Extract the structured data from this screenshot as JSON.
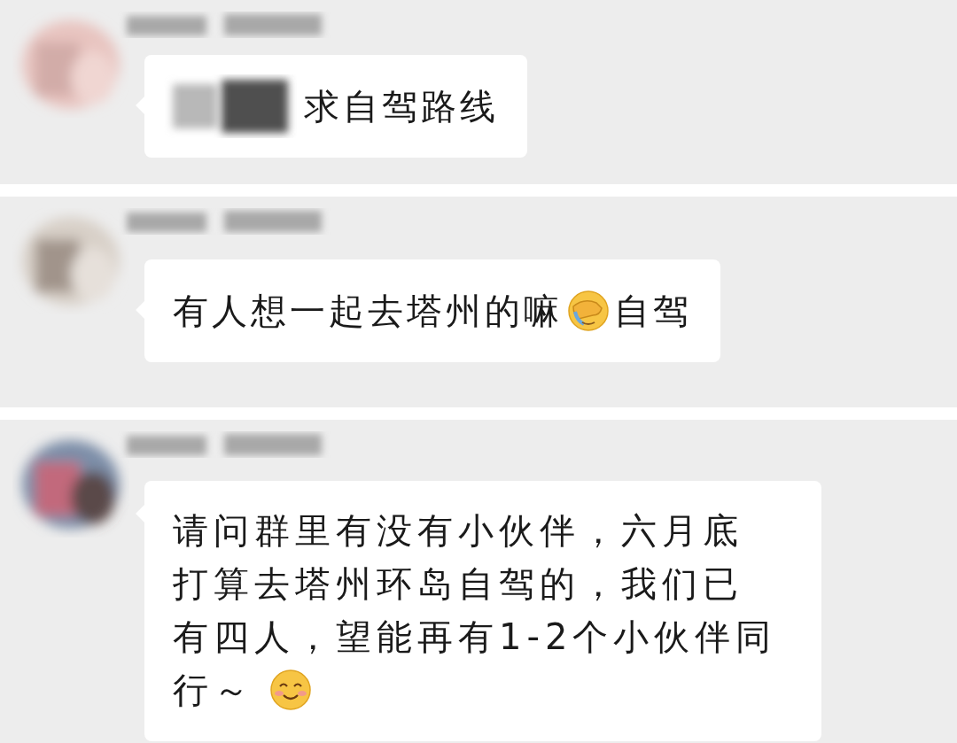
{
  "messages": [
    {
      "segments": [
        {
          "kind": "blurred"
        },
        {
          "kind": "text",
          "text": "求自驾路线"
        }
      ]
    },
    {
      "segments": [
        {
          "kind": "text",
          "text": "有人想一起去塔州的嘛"
        },
        {
          "kind": "facepalm"
        },
        {
          "kind": "text",
          "text": "自驾"
        }
      ]
    },
    {
      "segments": [
        {
          "kind": "text",
          "text": "请问群里有没有小伙伴，六月底"
        },
        {
          "kind": "text",
          "text": "打算去塔州环岛自驾的，我们已"
        },
        {
          "kind": "text",
          "text": "有四人，望能再有1-2个小伙伴同"
        },
        {
          "kind": "text",
          "text": "行～"
        },
        {
          "kind": "smile"
        }
      ]
    }
  ]
}
